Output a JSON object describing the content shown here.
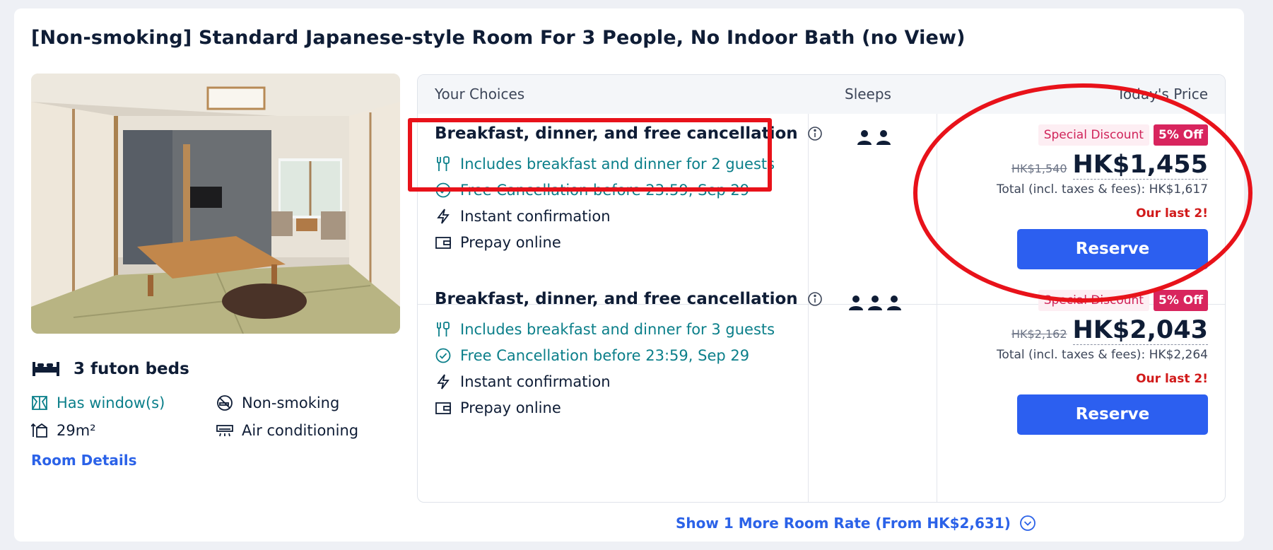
{
  "room": {
    "title": "[Non-smoking] Standard Japanese-style Room For 3 People, No Indoor Bath (no View)",
    "beds": "3 futon beds",
    "amenities": [
      {
        "label": "Has window(s)",
        "icon": "window-icon",
        "highlighted": true
      },
      {
        "label": "Non-smoking",
        "icon": "no-smoking-icon",
        "highlighted": false
      },
      {
        "label": "29m²",
        "icon": "room-size-icon",
        "highlighted": false
      },
      {
        "label": "Air conditioning",
        "icon": "air-conditioning-icon",
        "highlighted": false
      }
    ],
    "details_link": "Room Details"
  },
  "table": {
    "headers": {
      "choices": "Your Choices",
      "sleeps": "Sleeps",
      "price": "Today's Price"
    },
    "rows": [
      {
        "title": "Breakfast, dinner, and free cancellation",
        "meal": "Includes breakfast and dinner for 2 guests",
        "cancellation": "Free Cancellation before 23:59, Sep 29",
        "confirmation": "Instant confirmation",
        "payment": "Prepay online",
        "sleeps": 2,
        "badge_special": "Special Discount",
        "badge_off": "5% Off",
        "old_price": "HK$1,540",
        "price": "HK$1,455",
        "total": "Total (incl. taxes & fees): HK$1,617",
        "availability": "Our last 2!",
        "button": "Reserve"
      },
      {
        "title": "Breakfast, dinner, and free cancellation",
        "meal": "Includes breakfast and dinner for 3 guests",
        "cancellation": "Free Cancellation before 23:59, Sep 29",
        "confirmation": "Instant confirmation",
        "payment": "Prepay online",
        "sleeps": 3,
        "badge_special": "Special Discount",
        "badge_off": "5% Off",
        "old_price": "HK$2,162",
        "price": "HK$2,043",
        "total": "Total (incl. taxes & fees): HK$2,264",
        "availability": "Our last 2!",
        "button": "Reserve"
      }
    ]
  },
  "more_rates": "Show 1 More Room Rate (From HK$2,631)",
  "colors": {
    "accent": "#2c5ff0",
    "teal": "#0b7f8a",
    "discount": "#d8255e",
    "warning": "#d11a1a",
    "annotation": "#e8121a"
  }
}
